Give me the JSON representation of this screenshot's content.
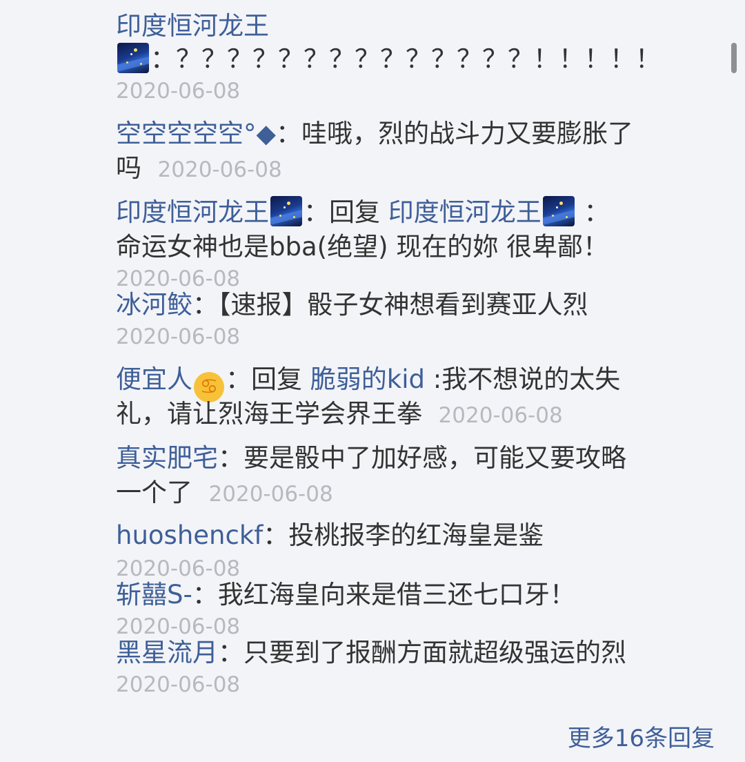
{
  "comments": [
    {
      "user": "印度恒河龙王",
      "body_line1": "：？？？？？？？？？？？？？？！！！！！",
      "date": "2020-06-08"
    },
    {
      "user": "空空空空空°◆",
      "body": "：哇哦，烈的战斗力又要膨胀了",
      "body2": "吗",
      "date": "2020-06-08"
    },
    {
      "user": "印度恒河龙王",
      "reply_label": "：回复",
      "reply_to": "印度恒河龙王",
      "after": "：",
      "line2": "命运女神也是bba(绝望) 现在的妳 很卑鄙！",
      "date": "2020-06-08"
    },
    {
      "user": "冰河鲛",
      "body": "：【速报】骰子女神想看到赛亚人烈",
      "date": "2020-06-08"
    },
    {
      "user": "便宜人",
      "reply_label": "：回复",
      "reply_to": "脆弱的kid",
      "after": ":我不想说的太失",
      "line2": "礼，请让烈海王学会界王拳",
      "date": "2020-06-08"
    },
    {
      "user": "真实肥宅",
      "body": "：要是骰中了加好感，可能又要攻略",
      "body2": "一个了",
      "date": "2020-06-08"
    },
    {
      "user": "huoshenckf",
      "body": "：投桃报李的红海皇是鉴",
      "date": "2020-06-08"
    },
    {
      "user": "斩囍S-",
      "body": "：我红海皇向来是借三还七口牙！",
      "date": "2020-06-08"
    },
    {
      "user": "黑星流月",
      "body": "：只要到了报酬方面就超级强运的烈",
      "date": "2020-06-08"
    }
  ],
  "more_replies": "更多16条回复",
  "icons": {
    "night": "night-sky-emoji",
    "cancer": "cancer-zodiac-emoji"
  }
}
